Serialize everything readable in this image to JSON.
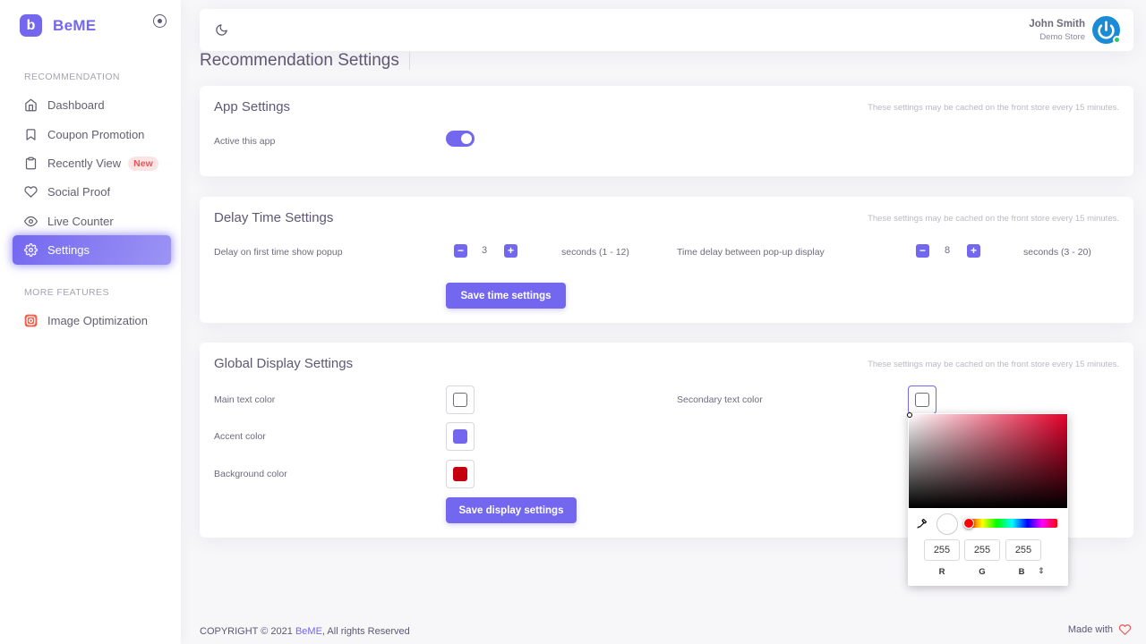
{
  "brand": {
    "logo_letter": "b",
    "name": "BeME"
  },
  "sidebar": {
    "section_recommendation": "RECOMMENDATION",
    "items": [
      {
        "label": "Dashboard",
        "icon": "home-icon"
      },
      {
        "label": "Coupon Promotion",
        "icon": "bookmark-icon"
      },
      {
        "label": "Recently View",
        "icon": "clipboard-icon",
        "badge": "New"
      },
      {
        "label": "Social Proof",
        "icon": "heart-icon"
      },
      {
        "label": "Live Counter",
        "icon": "eye-icon"
      },
      {
        "label": "Settings",
        "icon": "settings-icon",
        "active": true
      }
    ],
    "section_more": "MORE FEATURES",
    "more_items": [
      {
        "label": "Image Optimization",
        "icon": "instagram-icon"
      }
    ]
  },
  "navbar": {
    "theme_icon": "moon-icon",
    "user_name": "John Smith",
    "user_store": "Demo Store"
  },
  "page": {
    "title": "Recommendation Settings"
  },
  "app_settings": {
    "title": "App Settings",
    "note": "These settings may be cached on the front store every 15 minutes.",
    "active_label": "Active this app",
    "active": true
  },
  "delay_settings": {
    "title": "Delay Time Settings",
    "note": "These settings may be cached on the front store every 15 minutes.",
    "first_label": "Delay on first time show popup",
    "first_value": "3",
    "first_unit": "seconds (1 - 12)",
    "between_label": "Time delay between pop-up display",
    "between_value": "8",
    "between_unit": "seconds (3 - 20)",
    "minus": "−",
    "plus": "+",
    "save_label": "Save time settings"
  },
  "display_settings": {
    "title": "Global Display Settings",
    "note": "These settings may be cached on the front store every 15 minutes.",
    "main_text_label": "Main text color",
    "accent_label": "Accent color",
    "background_label": "Background color",
    "secondary_text_label": "Secondary text color",
    "save_label": "Save display settings",
    "colors": {
      "main_text": "#ffffff",
      "accent": "#7367f0",
      "background": "#c4000f",
      "secondary_text": "#ffffff"
    }
  },
  "color_picker": {
    "r": "255",
    "g": "255",
    "b": "255",
    "r_label": "R",
    "g_label": "G",
    "b_label": "B",
    "mode_toggle": "⇕"
  },
  "footer": {
    "copyright_prefix": "COPYRIGHT © 2021 ",
    "copyright_brand": "BeME",
    "copyright_suffix": ", All rights Reserved",
    "made_with": "Made with"
  }
}
